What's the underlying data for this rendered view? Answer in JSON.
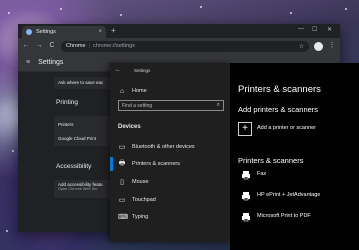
{
  "chrome": {
    "tab_title": "Settings",
    "tab_close": "×",
    "new_tab": "+",
    "win_min": "—",
    "win_max": "☐",
    "win_close": "✕",
    "back_icon": "←",
    "forward_icon": "→",
    "reload_icon": "C",
    "brand": "Chrome",
    "separator": "|",
    "url": "chrome://settings",
    "star_icon": "☆",
    "menu_icon": "⋮",
    "page_title": "Settings",
    "hamburger_icon": "≡"
  },
  "settings_page": {
    "ask_where_to_save": "Ask where to save eac",
    "printing_section": "Printing",
    "printers_row": "Printers",
    "google_cloud_print": "Google Cloud Print",
    "accessibility_section": "Accessibility",
    "add_accessibility_features": "Add accessibility featu",
    "open_chrome_web_store": "Open Chrome Web Sto"
  },
  "windows_settings": {
    "title": "Settings",
    "back_icon": "←",
    "home_label": "Home",
    "home_icon": "⌂",
    "search_placeholder": "Find a setting",
    "search_icon": "⌕",
    "category": "Devices",
    "nav": [
      {
        "label": "Bluetooth & other devices",
        "icon": "▭"
      },
      {
        "label": "Printers & scanners",
        "icon": "🖶"
      },
      {
        "label": "Mouse",
        "icon": "▯"
      },
      {
        "label": "Touchpad",
        "icon": "▭"
      },
      {
        "label": "Typing",
        "icon": "⌨"
      }
    ],
    "accent": "#0078d7"
  },
  "printers_panel": {
    "heading": "Printers & scanners",
    "add_heading": "Add printers & scanners",
    "add_icon": "+",
    "add_label": "Add a printer or scanner",
    "list_heading": "Printers & scanners",
    "devices": [
      {
        "label": "Fax"
      },
      {
        "label": "HP ePrint + JetAdvantage"
      },
      {
        "label": "Microsoft Print to PDF"
      }
    ]
  }
}
